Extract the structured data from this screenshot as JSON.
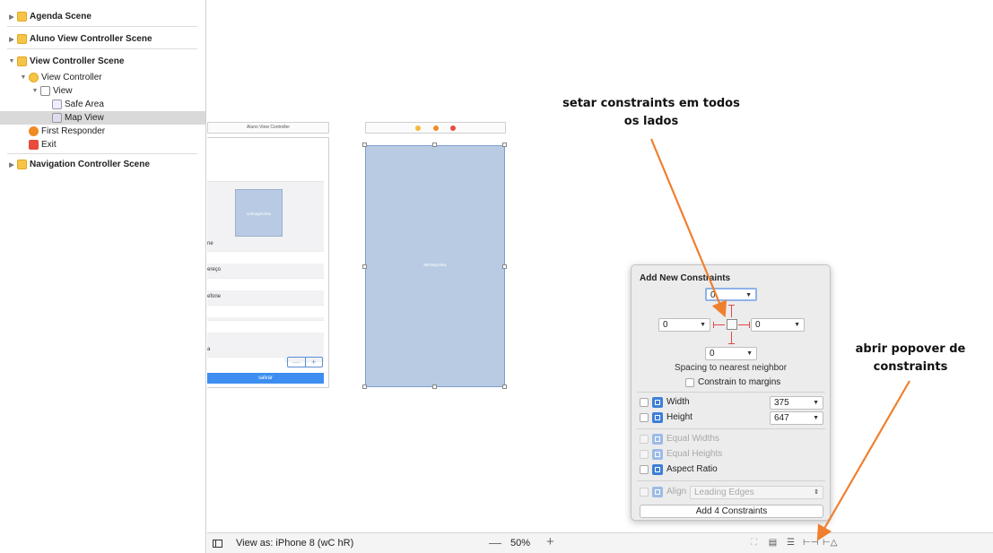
{
  "outline": {
    "items": [
      {
        "label": "Agenda Scene",
        "indent": 0,
        "expanded": false,
        "icon": "scene-icon",
        "scene": true
      },
      {
        "label": "Aluno View Controller Scene",
        "indent": 0,
        "expanded": false,
        "icon": "scene-icon",
        "scene": true
      },
      {
        "label": "View Controller Scene",
        "indent": 0,
        "expanded": true,
        "icon": "scene-icon",
        "scene": true
      },
      {
        "label": "View Controller",
        "indent": 1,
        "expanded": true,
        "icon": "view-controller-icon"
      },
      {
        "label": "View",
        "indent": 2,
        "expanded": true,
        "icon": "view-icon"
      },
      {
        "label": "Safe Area",
        "indent": 3,
        "icon": "safe-area-icon"
      },
      {
        "label": "Map View",
        "indent": 3,
        "icon": "map-view-icon",
        "selected": true
      },
      {
        "label": "First Responder",
        "indent": 1,
        "icon": "first-responder-icon"
      },
      {
        "label": "Exit",
        "indent": 1,
        "icon": "exit-icon"
      },
      {
        "label": "Navigation Controller Scene",
        "indent": 0,
        "expanded": false,
        "icon": "scene-icon",
        "scene": true
      }
    ]
  },
  "canvas": {
    "aluno_title": "Aluno View Controller",
    "aluno_photo_label": "UIImageView",
    "aluno_fields": [
      "ne",
      "ereço",
      "efone",
      "a"
    ],
    "aluno_stepper_minus": "—",
    "aluno_stepper_plus": "+",
    "aluno_save": "salvar",
    "map_label": "MKMapView",
    "dock_colors": [
      "#f6b93b",
      "#f08a24",
      "#e74c3c"
    ]
  },
  "popover": {
    "title": "Add New Constraints",
    "top_value": "0",
    "left_value": "0",
    "right_value": "0",
    "bottom_value": "0",
    "spacing_label": "Spacing to nearest neighbor",
    "constrain_margins_label": "Constrain to margins",
    "width_label": "Width",
    "width_value": "375",
    "height_label": "Height",
    "height_value": "647",
    "equal_widths_label": "Equal Widths",
    "equal_heights_label": "Equal Heights",
    "aspect_ratio_label": "Aspect Ratio",
    "align_label": "Align",
    "align_value": "Leading Edges",
    "add_button": "Add 4 Constraints",
    "strut_color": "#e04a4a"
  },
  "bottombar": {
    "view_as": "View as: iPhone 8 (wC hR)",
    "zoom_minus": "—",
    "zoom_level": "50%",
    "zoom_plus": "+"
  },
  "annotations": {
    "top_line1": "setar constraints em todos",
    "top_line2": "os lados",
    "right_line1": "abrir popover de",
    "right_line2": "constraints",
    "arrow_color": "#f07f2e"
  }
}
